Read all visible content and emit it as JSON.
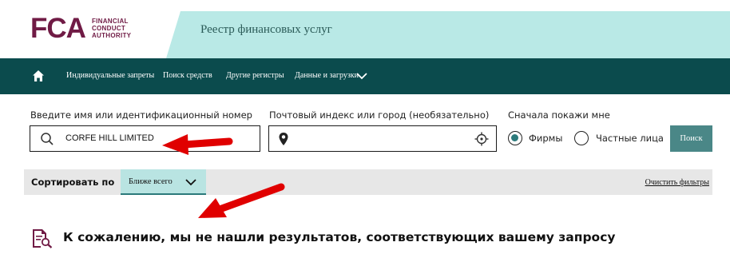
{
  "colors": {
    "brand": "#701b45",
    "header_band": "#b9e9e6",
    "nav_bg": "#0b4b4d",
    "radio_accent": "#2c7a7b",
    "search_button": "#4a8787",
    "sort_bar": "#e7e7e7",
    "sort_select": "#b9e4e2",
    "annotation_arrow": "#e00000"
  },
  "header": {
    "logo": {
      "mark": "FCA",
      "line1": "FINANCIAL",
      "line2": "CONDUCT",
      "line3": "AUTHORITY"
    },
    "register_title": "Реестр финансовых услуг"
  },
  "nav": {
    "home_icon": "home-icon",
    "items": [
      {
        "label": "Индивидуальные запреты"
      },
      {
        "label": "Поиск средств"
      },
      {
        "label": "Другие регистры"
      },
      {
        "label": "Данные и загрузки"
      }
    ],
    "dropdown_icon": "chevron-down-icon"
  },
  "search": {
    "name_label": "Введите имя или идентификационный номер",
    "name_value": "CORFE HILL LIMITED",
    "postal_label": "Почтовый индекс или город (необязательно)",
    "postal_value": "",
    "show_first_label": "Сначала покажи мне",
    "options": [
      {
        "label": "Фирмы",
        "selected": true
      },
      {
        "label": "Частные лица",
        "selected": false
      }
    ],
    "button_label": "Поиск"
  },
  "sort": {
    "label": "Сортировать по",
    "selected": "Ближе всего",
    "clear_filters": "Очистить фильтры"
  },
  "results": {
    "no_results_message": "К сожалению, мы не нашли результатов, соответствующих вашему запросу"
  }
}
